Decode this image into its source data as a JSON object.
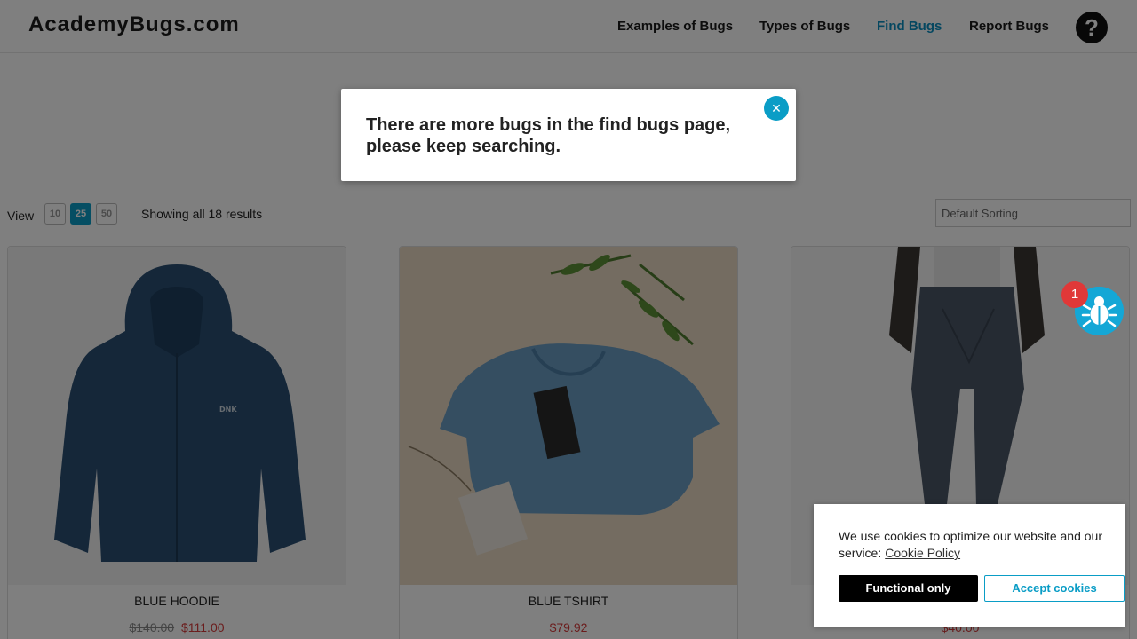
{
  "header": {
    "logo": "AcademyBugs.com",
    "nav": [
      {
        "label": "Examples of Bugs"
      },
      {
        "label": "Types of Bugs"
      },
      {
        "label": "Find Bugs",
        "active": true
      },
      {
        "label": "Report Bugs"
      }
    ],
    "help_icon": "question-circle-icon",
    "active_color": "#0b8fc0"
  },
  "toolbar": {
    "view_label": "View",
    "page_sizes": [
      "10",
      "25",
      "50"
    ],
    "selected_page_size": "25",
    "results_text": "Showing all 18 results",
    "sort_value": "Default Sorting"
  },
  "products": [
    {
      "name": "BLUE HOODIE",
      "old_price": "$140.00",
      "price": "$111.00"
    },
    {
      "name": "BLUE TSHIRT",
      "old_price": "",
      "price": "$79.92"
    },
    {
      "name": "",
      "old_price": "",
      "price": "$40.00"
    }
  ],
  "modal": {
    "message": "There are more bugs in the find bugs page, please keep searching.",
    "close_icon": "close-icon"
  },
  "bug_widget": {
    "icon": "bug-icon",
    "badge_count": "1",
    "color": "#14a7d6",
    "badge_color": "#e03838"
  },
  "cookie_banner": {
    "text": "We use cookies to optimize our website and our service:",
    "link": "Cookie Policy",
    "functional_label": "Functional only",
    "accept_label": "Accept cookies"
  },
  "colors": {
    "accent": "#0a9dc6",
    "sale": "#d63a3a"
  }
}
